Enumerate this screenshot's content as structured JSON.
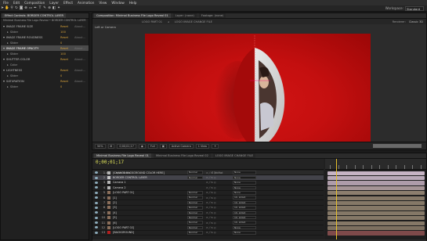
{
  "menu": [
    "File",
    "Edit",
    "Composition",
    "Layer",
    "Effect",
    "Animation",
    "View",
    "Window",
    "Help"
  ],
  "workspace": {
    "label": "Workspace:",
    "value": "Standard"
  },
  "effect_controls": {
    "tabs": [
      "Effect Controls: BORDER CONTROL LAYER"
    ],
    "breadcrumb": "Minimal Business File Logo Reveal • BORDER CONTROL LAYER",
    "rows": [
      {
        "name": "IMAGE FRAME SIZE",
        "reset": "Reset",
        "about": "About...",
        "kind": "fx"
      },
      {
        "name": "Slider",
        "reset": "100",
        "about": "",
        "kind": "sub"
      },
      {
        "name": "IMAGE FRAME ROUDNESS",
        "reset": "Reset",
        "about": "About...",
        "kind": "fx"
      },
      {
        "name": "Slider",
        "reset": "0",
        "about": "",
        "kind": "sub"
      },
      {
        "name": "IMAGE FRAME OPACITY",
        "reset": "Reset",
        "about": "About...",
        "kind": "fx-sel"
      },
      {
        "name": "Slider",
        "reset": "100",
        "about": "",
        "kind": "sub"
      },
      {
        "name": "SHUTTER COLOR",
        "reset": "Reset",
        "about": "About...",
        "kind": "fx"
      },
      {
        "name": "Color",
        "reset": "",
        "about": "",
        "kind": "sub"
      },
      {
        "name": "LIGHTNESS",
        "reset": "Reset",
        "about": "About...",
        "kind": "fx"
      },
      {
        "name": "Slider",
        "reset": "0",
        "about": "",
        "kind": "sub"
      },
      {
        "name": "SATURATION",
        "reset": "Reset",
        "about": "About...",
        "kind": "fx"
      },
      {
        "name": "Slider",
        "reset": "0",
        "about": "",
        "kind": "sub"
      }
    ]
  },
  "composition": {
    "tabs": [
      "Composition: Minimal Business File Logo Reveal 01",
      "Layer: (none)",
      "Footage: (none)"
    ],
    "sub_tabs": [
      "LOGO PART 01",
      "LOGO IMAGE CHANGE FILE"
    ],
    "right_tabs": [
      "Renderer:",
      "Classic 3D"
    ],
    "viewer_label": "Left or Camera",
    "bottom": {
      "zoom": "50%",
      "time": "0;00;01;17",
      "quality": "Full",
      "camera": "Active Camera",
      "views": "1 View"
    }
  },
  "timeline": {
    "tabs": [
      "Minimal Business File Logo Reveal 01",
      "Minimal Business File Logo Reveal 02",
      "LOGO IMAGE CHANGE FILE"
    ],
    "timecode": "0;00;01;17",
    "columns": [
      "#",
      "Layer Name",
      "Mode",
      "T TrkMat",
      "Parent"
    ],
    "layers": [
      {
        "num": "1",
        "name": "[CHANGE BACKGROUND COLOR HERE]",
        "color": "#b4b4b4",
        "mode": "Normal",
        "parent": "None",
        "sel": false
      },
      {
        "num": "2",
        "name": "BORDER CONTROL LAYER",
        "color": "#c8c8c8",
        "mode": "Normal",
        "parent": "None",
        "sel": true
      },
      {
        "num": "3",
        "name": "Camera 1",
        "color": "#b4b4b4",
        "mode": "",
        "parent": "None",
        "sel": false
      },
      {
        "num": "4",
        "name": "Camera 2",
        "color": "#b4b4b4",
        "mode": "",
        "parent": "None",
        "sel": false
      },
      {
        "num": "5",
        "name": "[LOGO PART 01]",
        "color": "#8a6e5a",
        "mode": "Normal",
        "parent": "None",
        "sel": false
      },
      {
        "num": "6",
        "name": "[1]",
        "color": "#8a6e5a",
        "mode": "Normal",
        "parent": "10. LOGO",
        "sel": false
      },
      {
        "num": "7",
        "name": "[2]",
        "color": "#8a6e5a",
        "mode": "Normal",
        "parent": "10. LOGO",
        "sel": false
      },
      {
        "num": "8",
        "name": "[3]",
        "color": "#8a6e5a",
        "mode": "Normal",
        "parent": "10. LOGO",
        "sel": false
      },
      {
        "num": "9",
        "name": "[4]",
        "color": "#8a6e5a",
        "mode": "Normal",
        "parent": "10. LOGO",
        "sel": false
      },
      {
        "num": "10",
        "name": "[5]",
        "color": "#8a6e5a",
        "mode": "Normal",
        "parent": "10. LOGO",
        "sel": false
      },
      {
        "num": "11",
        "name": "[6]",
        "color": "#8a6e5a",
        "mode": "Normal",
        "parent": "10. LOGO",
        "sel": false
      },
      {
        "num": "12",
        "name": "[LOGO PART 02]",
        "color": "#8a6e5a",
        "mode": "Normal",
        "parent": "None",
        "sel": false
      },
      {
        "num": "13",
        "name": "[BACKGROUND]",
        "color": "#b41e1e",
        "mode": "Normal",
        "parent": "None",
        "sel": false
      }
    ],
    "bar_colors": [
      "#c6b4c4",
      "#b9a9b8",
      "#ae9caa",
      "#a59496",
      "#8c7e6e",
      "#857867",
      "#857867",
      "#857867",
      "#857867",
      "#857867",
      "#857867",
      "#7d7060",
      "#7e4a4a"
    ]
  }
}
